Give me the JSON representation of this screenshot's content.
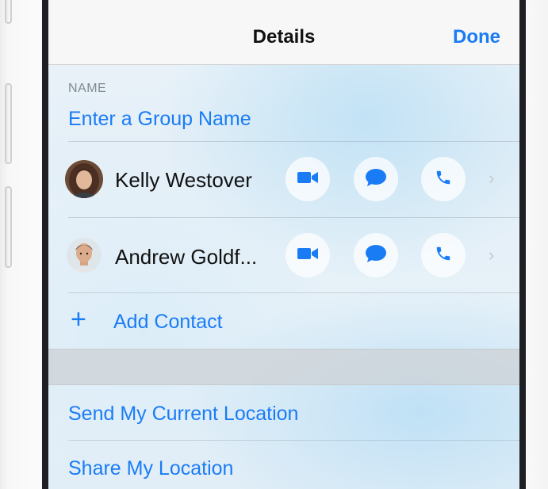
{
  "nav": {
    "title": "Details",
    "done_label": "Done"
  },
  "name_section": {
    "label": "NAME",
    "placeholder": "Enter a Group Name"
  },
  "contacts": [
    {
      "name": "Kelly Westover",
      "actions": [
        "video-icon",
        "message-icon",
        "phone-icon"
      ],
      "chevron": "›"
    },
    {
      "name": "Andrew Goldf...",
      "actions": [
        "video-icon",
        "message-icon",
        "phone-icon"
      ],
      "chevron": "›"
    }
  ],
  "add_contact": {
    "icon": "+",
    "label": "Add Contact"
  },
  "location": {
    "send_label": "Send My Current Location",
    "share_label": "Share My Location"
  },
  "colors": {
    "accent": "#1a7cf5",
    "label_gray": "#7f8a92",
    "bezel": "#1f2024"
  }
}
